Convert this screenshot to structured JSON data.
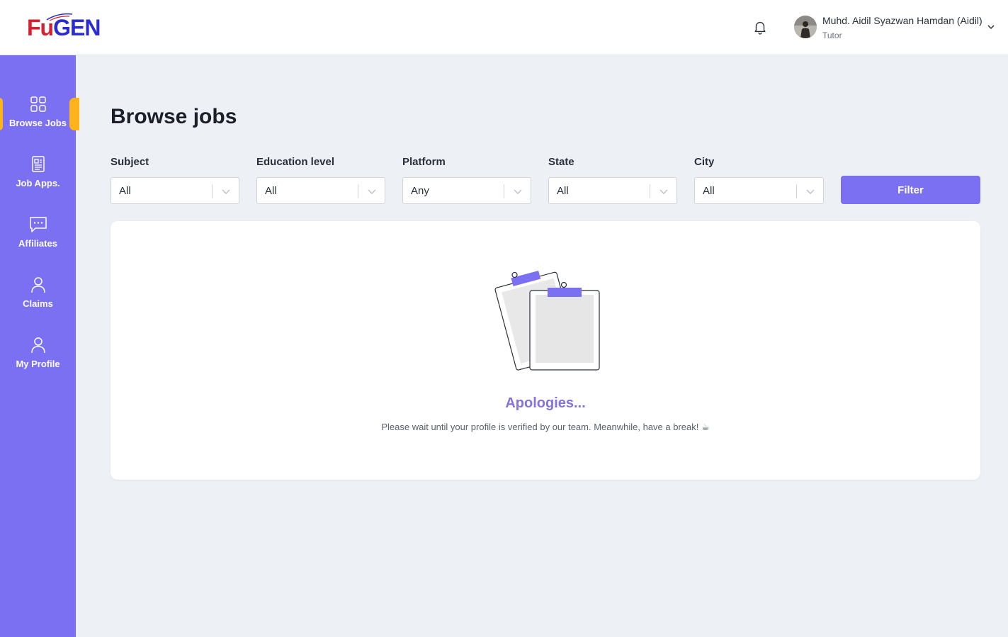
{
  "brand": {
    "logo_part1": "Fu",
    "logo_part2": "GEN"
  },
  "header": {
    "user_name": "Muhd. Aidil Syazwan Hamdan (Aidil)",
    "user_role": "Tutor"
  },
  "sidebar": {
    "items": [
      {
        "label": "Browse Jobs",
        "icon": "grid-icon",
        "active": true
      },
      {
        "label": "Job Apps.",
        "icon": "newspaper-icon",
        "active": false
      },
      {
        "label": "Affiliates",
        "icon": "chat-icon",
        "active": false
      },
      {
        "label": "Claims",
        "icon": "person-icon",
        "active": false
      },
      {
        "label": "My Profile",
        "icon": "person-icon",
        "active": false
      }
    ]
  },
  "page": {
    "title": "Browse jobs"
  },
  "filters": [
    {
      "label": "Subject",
      "value": "All"
    },
    {
      "label": "Education level",
      "value": "All"
    },
    {
      "label": "Platform",
      "value": "Any"
    },
    {
      "label": "State",
      "value": "All"
    },
    {
      "label": "City",
      "value": "All"
    }
  ],
  "filter_button": "Filter",
  "empty_state": {
    "title": "Apologies...",
    "message": "Please wait until your profile is verified by our team. Meanwhile, have a break! ☕"
  },
  "colors": {
    "accent": "#7b6ff2",
    "active_marker": "#ffb21a",
    "empty_title": "#8473dc"
  }
}
